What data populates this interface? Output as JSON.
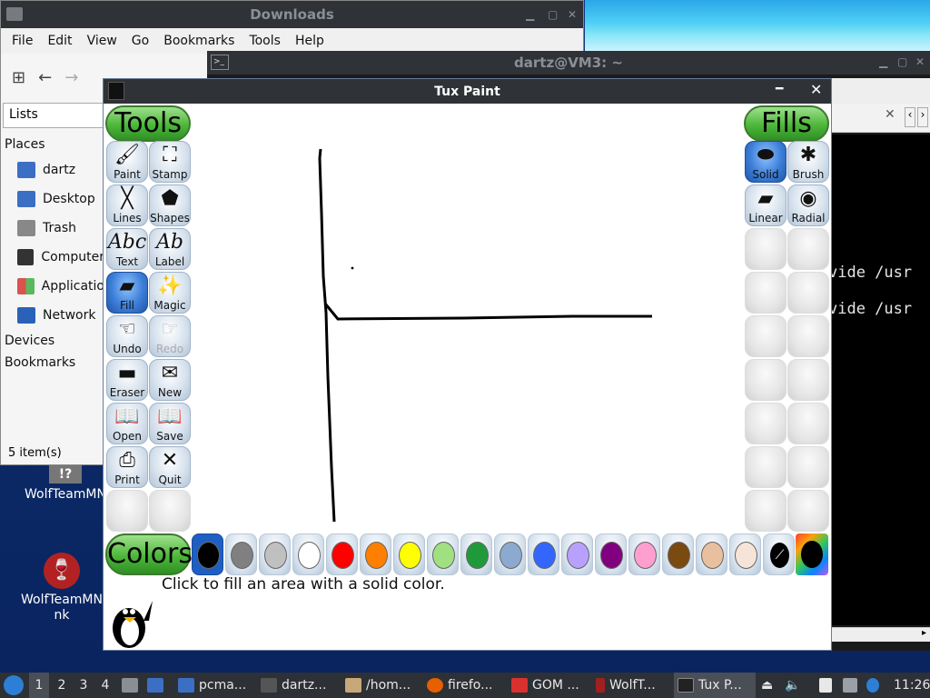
{
  "desktop": {
    "icons": [
      {
        "label": "WolfTeamMN",
        "icon": "question-file-icon"
      },
      {
        "label": "WolfTeamMN nk",
        "icon": "wine-glass-icon"
      }
    ]
  },
  "downloads": {
    "title": "Downloads",
    "menu": [
      "File",
      "Edit",
      "View",
      "Go",
      "Bookmarks",
      "Tools",
      "Help"
    ],
    "lists_label": "Lists",
    "places_header": "Places",
    "places": [
      {
        "label": "dartz",
        "color": "#3b6fc4"
      },
      {
        "label": "Desktop",
        "color": "#3b6fc4"
      },
      {
        "label": "Trash",
        "color": "#888888"
      },
      {
        "label": "Computer",
        "color": "#333333"
      },
      {
        "label": "Applicatio",
        "color": "#d9534f"
      },
      {
        "label": "Network",
        "color": "#2a62b8"
      }
    ],
    "devices_header": "Devices",
    "bookmarks_header": "Bookmarks",
    "status": "5 item(s)"
  },
  "terminal": {
    "title": "dartz@VM3: ~",
    "lines": [
      "vide /usr",
      "vide /usr"
    ]
  },
  "tuxpaint": {
    "title": "Tux Paint",
    "tools_header": "Tools",
    "fills_header": "Fills",
    "colors_header": "Colors",
    "tools": [
      {
        "label": "Paint",
        "glyph": "🖌"
      },
      {
        "label": "Stamp",
        "glyph": "⛶"
      },
      {
        "label": "Lines",
        "glyph": "╳"
      },
      {
        "label": "Shapes",
        "glyph": "⬟"
      },
      {
        "label": "Text",
        "glyph": "Abc"
      },
      {
        "label": "Label",
        "glyph": "Ab"
      },
      {
        "label": "Fill",
        "glyph": "▰"
      },
      {
        "label": "Magic",
        "glyph": "✨"
      },
      {
        "label": "Undo",
        "glyph": "☜"
      },
      {
        "label": "Redo",
        "glyph": "☞"
      },
      {
        "label": "Eraser",
        "glyph": "▬"
      },
      {
        "label": "New",
        "glyph": "✉"
      },
      {
        "label": "Open",
        "glyph": "📖"
      },
      {
        "label": "Save",
        "glyph": "📖"
      },
      {
        "label": "Print",
        "glyph": "⎙"
      },
      {
        "label": "Quit",
        "glyph": "✕"
      }
    ],
    "fills": [
      {
        "label": "Solid"
      },
      {
        "label": "Brush"
      },
      {
        "label": "Linear"
      },
      {
        "label": "Radial"
      }
    ],
    "palette": [
      "#000000",
      "#808080",
      "#c0c0c0",
      "#ffffff",
      "#ff0000",
      "#ff8000",
      "#ffff00",
      "#a0e080",
      "#1f9a3a",
      "#8caad0",
      "#3366ff",
      "#b8a0ff",
      "#800080",
      "#ff9fd0",
      "#7a4a10",
      "#e8c0a0",
      "#f7e4d8"
    ],
    "message": "Click to fill an area with a solid color."
  },
  "taskbar": {
    "workspaces": [
      "1",
      "2",
      "3",
      "4"
    ],
    "tasks": [
      {
        "label": "pcma...",
        "color": "#3b6fc4"
      },
      {
        "label": "dartz...",
        "color": "#555555"
      },
      {
        "label": "/hom...",
        "color": "#c8a878"
      },
      {
        "label": "firefo...",
        "color": "#e66000"
      },
      {
        "label": "GOM ...",
        "color": "#d93030"
      },
      {
        "label": "WolfT...",
        "color": "#a02020"
      },
      {
        "label": "Tux P...",
        "color": "#222222"
      }
    ],
    "clock": "11:26"
  }
}
